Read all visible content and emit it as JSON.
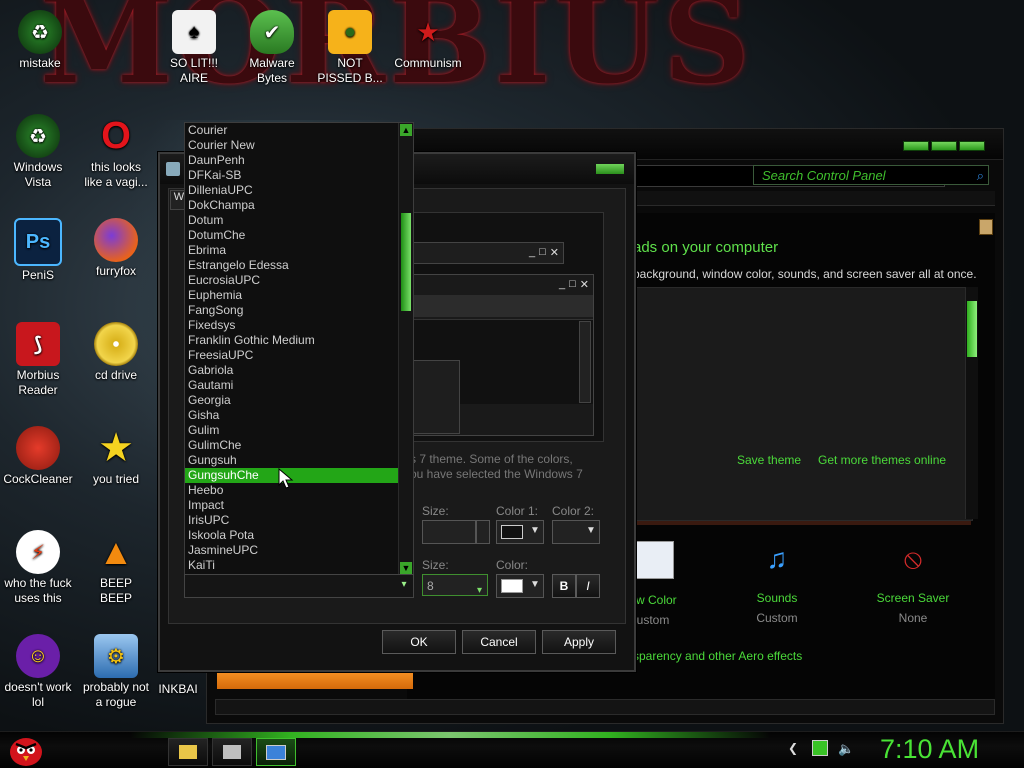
{
  "desktop": {
    "icons": [
      {
        "label": "mistake"
      },
      {
        "label": "SO LIT!!!\nAIRE"
      },
      {
        "label": "Malware\nBytes"
      },
      {
        "label": "NOT\nPISSED B..."
      },
      {
        "label": "Communism"
      },
      {
        "label": "Windows\nVista"
      },
      {
        "label": "this looks\nlike a vagi..."
      },
      {
        "label": "PeniS"
      },
      {
        "label": "furryfox"
      },
      {
        "label": "Morbius\nReader"
      },
      {
        "label": "cd drive"
      },
      {
        "label": "CockCleaner"
      },
      {
        "label": "you tried"
      },
      {
        "label": "who the fuck\nuses this"
      },
      {
        "label": "BEEP\nBEEP"
      },
      {
        "label": "doesn't work\nlol"
      },
      {
        "label": "probably not\na rogue"
      },
      {
        "label": "INKBAI"
      }
    ]
  },
  "control_panel": {
    "search_placeholder": "Search Control Panel",
    "heading": "ads on your computer",
    "subtext": "background, window color, sounds, and screen saver all at once.",
    "links": {
      "save_theme": "Save theme",
      "more_themes": "Get more themes online"
    },
    "bottom_items": [
      {
        "title": "ow Color",
        "sub": "ustom"
      },
      {
        "title": "Sounds",
        "sub": "Custom"
      },
      {
        "title": "Screen Saver",
        "sub": "None"
      }
    ],
    "aero_link": "sparency and other Aero effects"
  },
  "dialog": {
    "tab_stub": "W",
    "preview_text": "s 7 theme.  Some of the colors,\nou have selected the Windows 7",
    "labels": {
      "size1": "Size:",
      "color1": "Color 1:",
      "color2": "Color 2:",
      "size2": "Size:",
      "color": "Color:"
    },
    "font_size_value": "8",
    "bold_label": "B",
    "italic_label": "I",
    "buttons": {
      "ok": "OK",
      "cancel": "Cancel",
      "apply": "Apply"
    }
  },
  "font_list": {
    "items": [
      "Courier",
      "Courier New",
      "DaunPenh",
      "DFKai-SB",
      "DilleniaUPC",
      "DokChampa",
      "Dotum",
      "DotumChe",
      "Ebrima",
      "Estrangelo Edessa",
      "EucrosiaUPC",
      "Euphemia",
      "FangSong",
      "Fixedsys",
      "Franklin Gothic Medium",
      "FreesiaUPC",
      "Gabriola",
      "Gautami",
      "Georgia",
      "Gisha",
      "Gulim",
      "GulimChe",
      "Gungsuh",
      "GungsuhChe",
      "Heebo",
      "Impact",
      "IrisUPC",
      "Iskoola Pota",
      "JasmineUPC",
      "KaiTi"
    ],
    "selected": "GungsuhChe"
  },
  "taskbar": {
    "clock": "7:10 AM"
  },
  "colors": {
    "accent_green": "#3fbf2d",
    "selection": "#23a617",
    "clock": "#49e335"
  }
}
